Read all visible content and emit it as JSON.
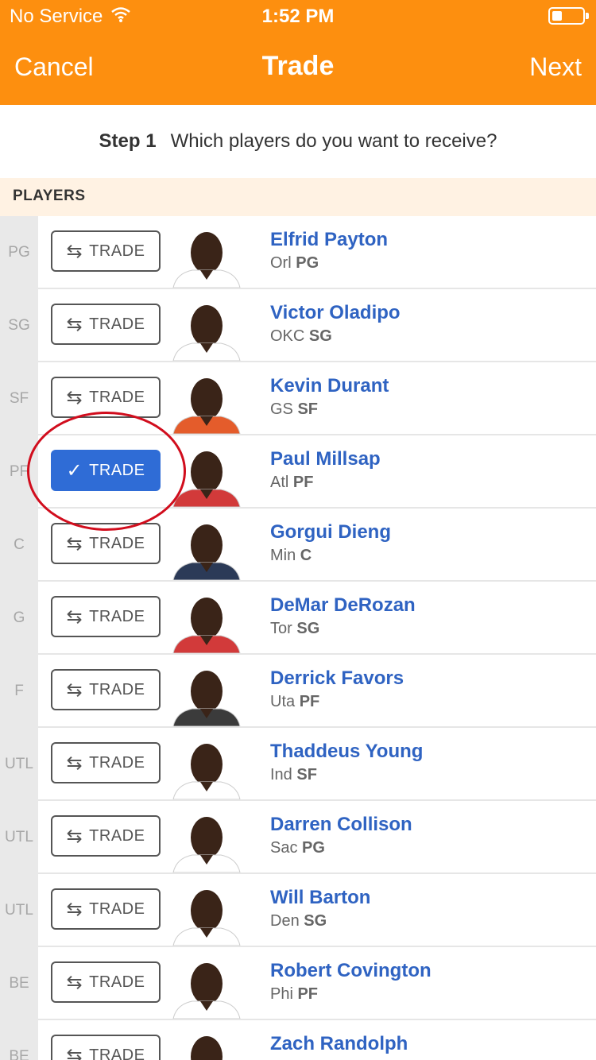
{
  "status_bar": {
    "carrier": "No Service",
    "time": "1:52 PM"
  },
  "header": {
    "cancel": "Cancel",
    "title": "Trade",
    "next": "Next"
  },
  "step": {
    "number": "Step 1",
    "prompt": "Which players do you want to receive?"
  },
  "section": {
    "title": "PLAYERS"
  },
  "colors": {
    "header_bg": "#fd8f0f",
    "selected_button": "#2f6cd6",
    "name_link": "#2f63c2",
    "annotation_circle": "#d10d1d"
  },
  "players": [
    {
      "position": "PG",
      "button_label": "TRADE",
      "selected": false,
      "name": "Elfrid Payton",
      "team": "Orl",
      "player_pos": "PG",
      "jersey": "#ffffff"
    },
    {
      "position": "SG",
      "button_label": "TRADE",
      "selected": false,
      "name": "Victor Oladipo",
      "team": "OKC",
      "player_pos": "SG",
      "jersey": "#ffffff"
    },
    {
      "position": "SF",
      "button_label": "TRADE",
      "selected": false,
      "name": "Kevin Durant",
      "team": "GS",
      "player_pos": "SF",
      "jersey": "#e45c2b"
    },
    {
      "position": "PF",
      "button_label": "TRADE",
      "selected": true,
      "name": "Paul Millsap",
      "team": "Atl",
      "player_pos": "PF",
      "jersey": "#d23a3a"
    },
    {
      "position": "C",
      "button_label": "TRADE",
      "selected": false,
      "name": "Gorgui Dieng",
      "team": "Min",
      "player_pos": "C",
      "jersey": "#2b3a57"
    },
    {
      "position": "G",
      "button_label": "TRADE",
      "selected": false,
      "name": "DeMar DeRozan",
      "team": "Tor",
      "player_pos": "SG",
      "jersey": "#d23a3a"
    },
    {
      "position": "F",
      "button_label": "TRADE",
      "selected": false,
      "name": "Derrick Favors",
      "team": "Uta",
      "player_pos": "PF",
      "jersey": "#3b3b3b"
    },
    {
      "position": "UTL",
      "button_label": "TRADE",
      "selected": false,
      "name": "Thaddeus Young",
      "team": "Ind",
      "player_pos": "SF",
      "jersey": "#ffffff"
    },
    {
      "position": "UTL",
      "button_label": "TRADE",
      "selected": false,
      "name": "Darren Collison",
      "team": "Sac",
      "player_pos": "PG",
      "jersey": "#ffffff"
    },
    {
      "position": "UTL",
      "button_label": "TRADE",
      "selected": false,
      "name": "Will Barton",
      "team": "Den",
      "player_pos": "SG",
      "jersey": "#ffffff"
    },
    {
      "position": "BE",
      "button_label": "TRADE",
      "selected": false,
      "name": "Robert Covington",
      "team": "Phi",
      "player_pos": "PF",
      "jersey": "#ffffff"
    },
    {
      "position": "BE",
      "button_label": "TRADE",
      "selected": false,
      "name": "Zach Randolph",
      "team": "",
      "player_pos": "",
      "jersey": "#ffffff"
    }
  ]
}
